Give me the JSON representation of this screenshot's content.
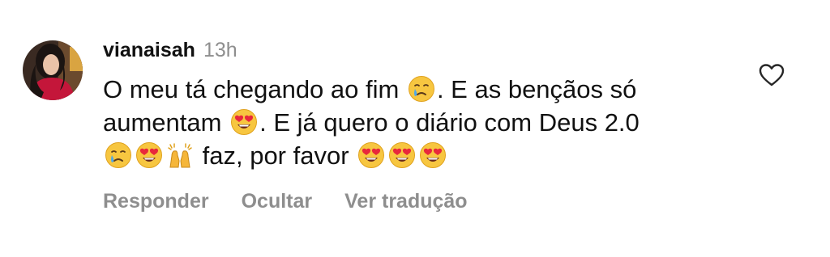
{
  "comment": {
    "username": "vianaisah",
    "time": "13h",
    "text": {
      "line1_a": "O meu tá chegando ao fim",
      "line1_b": ". E as bençãos só",
      "line2_a": "aumentam",
      "line2_b": ". E já quero o diário com Deus 2.0",
      "line3_b": "faz, por favor"
    },
    "emojis": {
      "crying": "crying-face-icon",
      "heart_eyes": "smiling-face-with-heart-eyes-icon",
      "raised_hands": "raising-hands-icon"
    },
    "actions": {
      "reply": "Responder",
      "hide": "Ocultar",
      "translate": "Ver tradução"
    },
    "like_icon": "heart-outline-icon"
  },
  "colors": {
    "text": "#111111",
    "muted": "#8e8e8e",
    "background": "#ffffff"
  }
}
